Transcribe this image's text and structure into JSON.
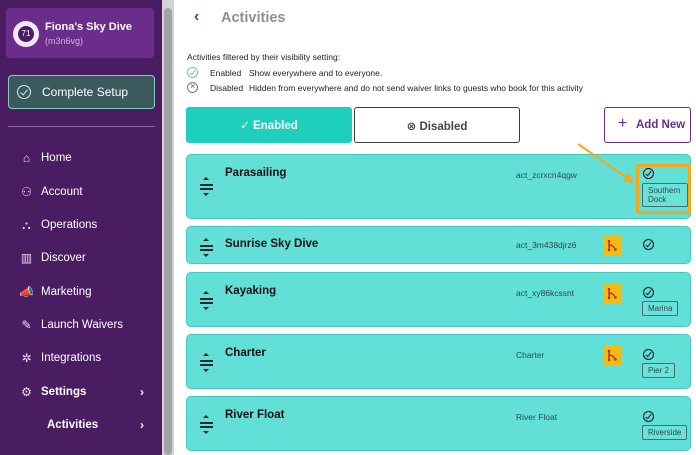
{
  "account": {
    "name": "Fiona's Sky Dive",
    "id": "(m3n6vg)",
    "avatar_text": "71"
  },
  "setup_button": {
    "label": "Complete Setup"
  },
  "nav": [
    {
      "label": "Home",
      "icon": "home-icon",
      "glyph": "⌂"
    },
    {
      "label": "Account",
      "icon": "user-icon",
      "glyph": "⚇"
    },
    {
      "label": "Operations",
      "icon": "operations-icon",
      "glyph": "⛬"
    },
    {
      "label": "Discover",
      "icon": "chart-icon",
      "glyph": "▥"
    },
    {
      "label": "Marketing",
      "icon": "megaphone-icon",
      "glyph": "📣"
    },
    {
      "label": "Launch Waivers",
      "icon": "waiver-icon",
      "glyph": "✎"
    },
    {
      "label": "Integrations",
      "icon": "integrations-icon",
      "glyph": "✲"
    },
    {
      "label": "Settings",
      "icon": "gear-icon",
      "glyph": "⚙"
    },
    {
      "label": "Activities",
      "icon": "",
      "glyph": ""
    }
  ],
  "header": {
    "back_glyph": "‹",
    "title": "Activities"
  },
  "filter": {
    "note": "Activities filtered by their visibility setting:",
    "enabled_label": "Enabled",
    "enabled_desc": "Show everywhere and to everyone.",
    "disabled_label": "Disabled",
    "disabled_desc": "Hidden from everywhere and do not send waiver links to guests who book for this activity"
  },
  "tabs": {
    "enabled": "Enabled",
    "disabled": "Disabled"
  },
  "add_button": {
    "label": "Add New"
  },
  "activities": [
    {
      "name": "Parasailing",
      "id": "act_zcrxcn4qgw",
      "waiver": false,
      "tag": "Southern Dock"
    },
    {
      "name": "Sunrise Sky Dive",
      "id": "act_3m438djrz6",
      "waiver": true,
      "tag": ""
    },
    {
      "name": "Kayaking",
      "id": "act_xy86kcssnt",
      "waiver": true,
      "tag": "Marina"
    },
    {
      "name": "Charter",
      "id": "Charter",
      "waiver": true,
      "tag": "Pier 2"
    },
    {
      "name": "River Float",
      "id": "River Float",
      "waiver": false,
      "tag": "Riverside"
    }
  ],
  "colors": {
    "sidebar": "#4a1d63",
    "accent": "#1fcfbd",
    "card": "#62e0d7",
    "highlight": "#f4a81d",
    "purple": "#6b2d8c"
  }
}
